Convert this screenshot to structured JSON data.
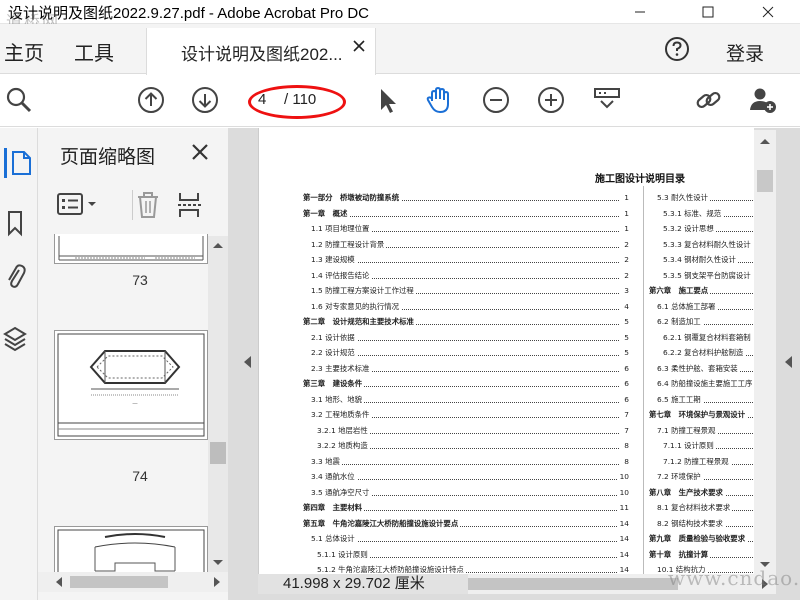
{
  "window": {
    "title": "设计说明及图纸2022.9.27.pdf - Adobe Acrobat Pro DC",
    "overlay_logo": "道桥网"
  },
  "tabs": {
    "home": "主页",
    "tools": "工具",
    "document": "设计说明及图纸202...",
    "login": "登录"
  },
  "toolbar": {
    "current_page": "4",
    "total_pages": "/ 110"
  },
  "thumbnails": {
    "title": "页面缩略图",
    "pages": [
      "73",
      "74"
    ]
  },
  "status": {
    "page_size": "41.998 x 29.702 厘米"
  },
  "document": {
    "toc_title": "施工图设计说明目录",
    "left_column": [
      {
        "text": "第一部分　桥墩被动防撞系统",
        "page": "1",
        "bold": true,
        "indent": 0
      },
      {
        "text": "第一章　概述",
        "page": "1",
        "bold": true,
        "indent": 0
      },
      {
        "text": "1.1 项目地理位置",
        "page": "1",
        "bold": false,
        "indent": 1
      },
      {
        "text": "1.2 防撞工程设计背景",
        "page": "2",
        "bold": false,
        "indent": 1
      },
      {
        "text": "1.3 建设规模",
        "page": "2",
        "bold": false,
        "indent": 1
      },
      {
        "text": "1.4 评估报告结论",
        "page": "2",
        "bold": false,
        "indent": 1
      },
      {
        "text": "1.5 防撞工程方案设计工作过程",
        "page": "3",
        "bold": false,
        "indent": 1
      },
      {
        "text": "1.6 对专家意见的执行情况",
        "page": "4",
        "bold": false,
        "indent": 1
      },
      {
        "text": "第二章　设计规范和主要技术标准",
        "page": "5",
        "bold": true,
        "indent": 0
      },
      {
        "text": "2.1 设计依据",
        "page": "5",
        "bold": false,
        "indent": 1
      },
      {
        "text": "2.2 设计规范",
        "page": "5",
        "bold": false,
        "indent": 1
      },
      {
        "text": "2.3 主要技术标准",
        "page": "6",
        "bold": false,
        "indent": 1
      },
      {
        "text": "第三章　建设条件",
        "page": "6",
        "bold": true,
        "indent": 0
      },
      {
        "text": "3.1 地形、地貌",
        "page": "6",
        "bold": false,
        "indent": 1
      },
      {
        "text": "3.2 工程地质条件",
        "page": "7",
        "bold": false,
        "indent": 1
      },
      {
        "text": "3.2.1 地层岩性",
        "page": "7",
        "bold": false,
        "indent": 2
      },
      {
        "text": "3.2.2 地质构造",
        "page": "8",
        "bold": false,
        "indent": 2
      },
      {
        "text": "3.3 地震",
        "page": "8",
        "bold": false,
        "indent": 1
      },
      {
        "text": "3.4 通航水位",
        "page": "10",
        "bold": false,
        "indent": 1
      },
      {
        "text": "3.5 通航净空尺寸",
        "page": "10",
        "bold": false,
        "indent": 1
      },
      {
        "text": "第四章　主要材料",
        "page": "11",
        "bold": true,
        "indent": 0
      },
      {
        "text": "第五章　牛角沱嘉陵江大桥防船撞设施设计要点",
        "page": "14",
        "bold": true,
        "indent": 0
      },
      {
        "text": "5.1 总体设计",
        "page": "14",
        "bold": false,
        "indent": 1
      },
      {
        "text": "5.1.1 设计原则",
        "page": "14",
        "bold": false,
        "indent": 2
      },
      {
        "text": "5.1.2 牛角沱嘉陵江大桥防船撞设施设计特点",
        "page": "14",
        "bold": false,
        "indent": 2
      }
    ],
    "right_column": [
      {
        "text": "5.3 耐久性设计",
        "bold": false,
        "indent": 1
      },
      {
        "text": "5.3.1 标准、规范",
        "bold": false,
        "indent": 2
      },
      {
        "text": "5.3.2 设计思想",
        "bold": false,
        "indent": 2
      },
      {
        "text": "5.3.3 复合材料耐久性设计",
        "bold": false,
        "indent": 2
      },
      {
        "text": "5.3.4 钢材耐久性设计",
        "bold": false,
        "indent": 2
      },
      {
        "text": "5.3.5 钢支架平台防腐设计",
        "bold": false,
        "indent": 2
      },
      {
        "text": "第六章　施工要点",
        "bold": true,
        "indent": 0
      },
      {
        "text": "6.1 总体施工部署",
        "bold": false,
        "indent": 1
      },
      {
        "text": "6.2 制造加工",
        "bold": false,
        "indent": 1
      },
      {
        "text": "6.2.1 钢覆复合材料套箱制",
        "bold": false,
        "indent": 2
      },
      {
        "text": "6.2.2 复合材料护舷制造",
        "bold": false,
        "indent": 2
      },
      {
        "text": "6.3 柔性护舷、套箱安装",
        "bold": false,
        "indent": 1
      },
      {
        "text": "6.4 防船撞设施主要施工工序",
        "bold": false,
        "indent": 1
      },
      {
        "text": "6.5 施工工期",
        "bold": false,
        "indent": 1
      },
      {
        "text": "第七章　环境保护与景观设计",
        "bold": true,
        "indent": 0
      },
      {
        "text": "7.1 防撞工程景观",
        "bold": false,
        "indent": 1
      },
      {
        "text": "7.1.1 设计原则",
        "bold": false,
        "indent": 2
      },
      {
        "text": "7.1.2 防撞工程景观",
        "bold": false,
        "indent": 2
      },
      {
        "text": "7.2 环境保护",
        "bold": false,
        "indent": 1
      },
      {
        "text": "第八章　生产技术要求",
        "bold": true,
        "indent": 0
      },
      {
        "text": "8.1 复合材料技术要求",
        "bold": false,
        "indent": 1
      },
      {
        "text": "8.2 钢结构技术要求",
        "bold": false,
        "indent": 1
      },
      {
        "text": "第九章　质量检验与验收要求",
        "bold": true,
        "indent": 0
      },
      {
        "text": "第十章　抗撞计算",
        "bold": true,
        "indent": 0
      },
      {
        "text": "10.1 结构抗力",
        "bold": false,
        "indent": 1
      }
    ]
  },
  "watermark": "www.cndao.com",
  "colors": {
    "annotation_oval": "#e11111",
    "panel_bg": "#f4f4f4",
    "document_bg": "#dcdcdc",
    "accent_blue": "#1a6fd6"
  }
}
